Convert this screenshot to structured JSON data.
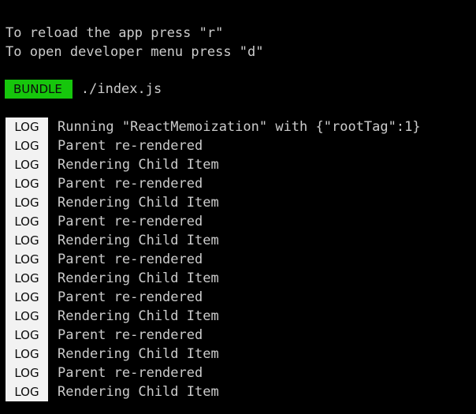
{
  "hints": [
    "To reload the app press \"r\"",
    "To open developer menu press \"d\""
  ],
  "bundle": {
    "badge": "BUNDLE",
    "path": "./index.js"
  },
  "log_badge": "LOG",
  "logs": [
    "Running \"ReactMemoization\" with {\"rootTag\":1}",
    "Parent re-rendered",
    "Rendering Child Item",
    "Parent re-rendered",
    "Rendering Child Item",
    "Parent re-rendered",
    "Rendering Child Item",
    "Parent re-rendered",
    "Rendering Child Item",
    "Parent re-rendered",
    "Rendering Child Item",
    "Parent re-rendered",
    "Rendering Child Item",
    "Parent re-rendered",
    "Rendering Child Item"
  ],
  "colors": {
    "background": "#000000",
    "text": "#cccccc",
    "bundle_badge": "#16c60c",
    "log_badge": "#f2f2f2"
  }
}
